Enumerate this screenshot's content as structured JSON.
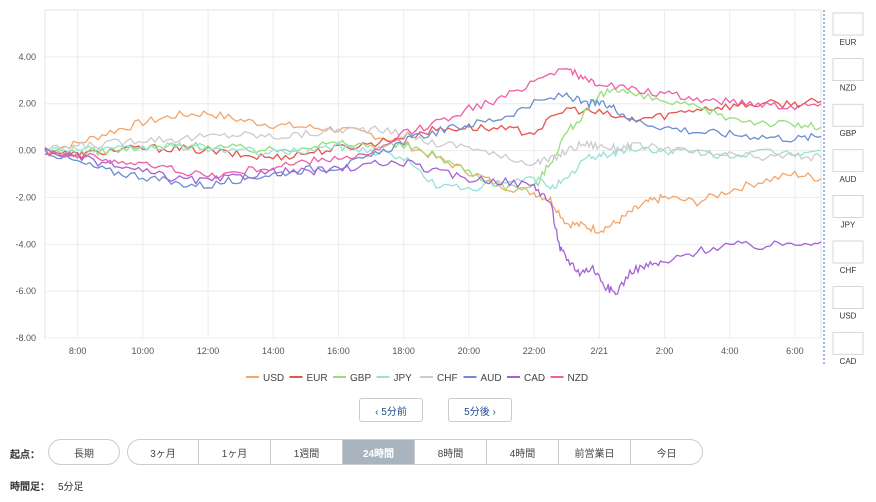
{
  "chart_data": {
    "type": "line",
    "y_ticks": [
      "4.00",
      "2.00",
      "0.00",
      "-2.00",
      "-4.00",
      "-6.00",
      "-8.00"
    ],
    "ylim": [
      -8,
      6
    ],
    "x_ticks": [
      "8:00",
      "10:00",
      "12:00",
      "14:00",
      "16:00",
      "18:00",
      "20:00",
      "22:00",
      "2/21",
      "2:00",
      "4:00",
      "6:00"
    ],
    "x_tick_hours": [
      1,
      3,
      5,
      7,
      9,
      11,
      13,
      15,
      17,
      19,
      21,
      23
    ],
    "xlim": [
      0,
      23.8
    ],
    "series": [
      {
        "name": "USD",
        "color": "#f4a56b",
        "points": [
          [
            0,
            0
          ],
          [
            1,
            0.3
          ],
          [
            2,
            0.8
          ],
          [
            3,
            1.2
          ],
          [
            4,
            1.5
          ],
          [
            5,
            1.6
          ],
          [
            6,
            1.3
          ],
          [
            7,
            1.1
          ],
          [
            8,
            1.0
          ],
          [
            9,
            0.9
          ],
          [
            10,
            0.7
          ],
          [
            11,
            0.3
          ],
          [
            12,
            -0.3
          ],
          [
            13,
            -0.9
          ],
          [
            14,
            -1.5
          ],
          [
            15,
            -1.8
          ],
          [
            15.5,
            -2.1
          ],
          [
            16,
            -3.1
          ],
          [
            16.5,
            -3.2
          ],
          [
            17,
            -3.4
          ],
          [
            17.5,
            -3.1
          ],
          [
            18,
            -2.6
          ],
          [
            18.5,
            -2.2
          ],
          [
            19,
            -2.0
          ],
          [
            20,
            -2.2
          ],
          [
            21,
            -1.7
          ],
          [
            22,
            -1.3
          ],
          [
            23,
            -1.0
          ],
          [
            23.8,
            -1.2
          ]
        ]
      },
      {
        "name": "EUR",
        "color": "#e8534d",
        "points": [
          [
            0,
            0
          ],
          [
            1,
            -0.2
          ],
          [
            2,
            0
          ],
          [
            3,
            0.1
          ],
          [
            4,
            0.1
          ],
          [
            5,
            0
          ],
          [
            6,
            -0.2
          ],
          [
            7,
            -0.3
          ],
          [
            8,
            -0.1
          ],
          [
            9,
            0.1
          ],
          [
            10,
            0.3
          ],
          [
            11,
            0.6
          ],
          [
            12,
            0.9
          ],
          [
            13,
            1.0
          ],
          [
            14,
            0.9
          ],
          [
            15,
            0.8
          ],
          [
            16,
            1.8
          ],
          [
            17,
            1.6
          ],
          [
            18,
            1.3
          ],
          [
            19,
            1.5
          ],
          [
            20,
            1.8
          ],
          [
            21,
            1.9
          ],
          [
            22,
            2.0
          ],
          [
            23,
            2.0
          ],
          [
            23.8,
            2.1
          ]
        ]
      },
      {
        "name": "GBP",
        "color": "#93e07b",
        "points": [
          [
            0,
            0
          ],
          [
            1,
            -0.1
          ],
          [
            2,
            0
          ],
          [
            3,
            0.1
          ],
          [
            4,
            0.2
          ],
          [
            5,
            0.2
          ],
          [
            6,
            0.1
          ],
          [
            7,
            0
          ],
          [
            8,
            0.2
          ],
          [
            9,
            0.3
          ],
          [
            10,
            0.2
          ],
          [
            11,
            0.2
          ],
          [
            12,
            -0.2
          ],
          [
            13,
            -0.9
          ],
          [
            14,
            -1.5
          ],
          [
            15,
            -1.6
          ],
          [
            15.5,
            -0.5
          ],
          [
            16,
            0.8
          ],
          [
            16.5,
            1.5
          ],
          [
            17,
            2.3
          ],
          [
            17.5,
            2.7
          ],
          [
            18,
            2.4
          ],
          [
            19,
            2.1
          ],
          [
            20,
            1.8
          ],
          [
            21,
            1.4
          ],
          [
            22,
            1.2
          ],
          [
            23,
            1.1
          ],
          [
            23.8,
            1.0
          ]
        ]
      },
      {
        "name": "JPY",
        "color": "#95e2d8",
        "points": [
          [
            0,
            0
          ],
          [
            1,
            0.1
          ],
          [
            2,
            0
          ],
          [
            3,
            0.1
          ],
          [
            4,
            0.2
          ],
          [
            5,
            0.1
          ],
          [
            6,
            0
          ],
          [
            7,
            -0.1
          ],
          [
            8,
            0
          ],
          [
            9,
            0.2
          ],
          [
            10,
            0
          ],
          [
            11,
            -0.3
          ],
          [
            12,
            -1.5
          ],
          [
            13,
            -1.6
          ],
          [
            14,
            -1.4
          ],
          [
            15,
            -1.2
          ],
          [
            15.5,
            -1.5
          ],
          [
            16,
            -1.3
          ],
          [
            16.5,
            -0.4
          ],
          [
            17,
            -0.2
          ],
          [
            17.5,
            -0.1
          ],
          [
            18,
            0.1
          ],
          [
            19,
            0.0
          ],
          [
            20,
            -0.1
          ],
          [
            21,
            -0.2
          ],
          [
            22,
            -0.1
          ],
          [
            23,
            -0.1
          ],
          [
            23.8,
            0.0
          ]
        ]
      },
      {
        "name": "CHF",
        "color": "#cccccc",
        "points": [
          [
            0,
            0
          ],
          [
            1,
            0.2
          ],
          [
            2,
            0.3
          ],
          [
            3,
            0.5
          ],
          [
            4,
            0.5
          ],
          [
            5,
            0.6
          ],
          [
            6,
            0.7
          ],
          [
            7,
            0.6
          ],
          [
            8,
            0.7
          ],
          [
            9,
            0.9
          ],
          [
            10,
            0.9
          ],
          [
            11,
            0.7
          ],
          [
            12,
            0.3
          ],
          [
            13,
            0.2
          ],
          [
            14,
            -0.3
          ],
          [
            15,
            -0.5
          ],
          [
            15.5,
            -0.4
          ],
          [
            16,
            0
          ],
          [
            16.5,
            0.3
          ],
          [
            17,
            0.2
          ],
          [
            17.5,
            0.1
          ],
          [
            18,
            0.2
          ],
          [
            19,
            0.1
          ],
          [
            20,
            -0.1
          ],
          [
            21,
            -0.2
          ],
          [
            22,
            -0.3
          ],
          [
            23,
            -0.2
          ],
          [
            23.8,
            -0.3
          ]
        ]
      },
      {
        "name": "AUD",
        "color": "#6c8fd0",
        "points": [
          [
            0,
            0
          ],
          [
            1,
            -0.5
          ],
          [
            2,
            -0.9
          ],
          [
            3,
            -1.1
          ],
          [
            4,
            -1.4
          ],
          [
            5,
            -1.5
          ],
          [
            6,
            -1.2
          ],
          [
            7,
            -1.0
          ],
          [
            8,
            -0.8
          ],
          [
            9,
            -0.7
          ],
          [
            10,
            -0.3
          ],
          [
            11,
            0.4
          ],
          [
            12,
            0.8
          ],
          [
            13,
            1.1
          ],
          [
            14,
            1.4
          ],
          [
            15,
            2.0
          ],
          [
            16,
            2.4
          ],
          [
            16.5,
            2.0
          ],
          [
            17,
            2.0
          ],
          [
            17.5,
            1.8
          ],
          [
            18,
            1.3
          ],
          [
            19,
            1.0
          ],
          [
            20,
            0.8
          ],
          [
            21,
            0.7
          ],
          [
            22,
            0.6
          ],
          [
            23,
            0.5
          ],
          [
            23.8,
            0.6
          ]
        ]
      },
      {
        "name": "CAD",
        "color": "#a462d6",
        "points": [
          [
            0,
            0
          ],
          [
            1,
            -0.3
          ],
          [
            2,
            -0.6
          ],
          [
            3,
            -0.9
          ],
          [
            4,
            -1.2
          ],
          [
            5,
            -1.3
          ],
          [
            6,
            -1.1
          ],
          [
            7,
            -0.9
          ],
          [
            8,
            -0.9
          ],
          [
            9,
            -0.8
          ],
          [
            10,
            -0.6
          ],
          [
            11,
            -0.5
          ],
          [
            12,
            -0.9
          ],
          [
            13,
            -1.2
          ],
          [
            14,
            -1.3
          ],
          [
            15,
            -1.5
          ],
          [
            15.5,
            -2.2
          ],
          [
            15.8,
            -4.2
          ],
          [
            16,
            -4.6
          ],
          [
            16.4,
            -5.2
          ],
          [
            16.8,
            -5.0
          ],
          [
            17.2,
            -5.8
          ],
          [
            17.5,
            -6.1
          ],
          [
            18,
            -5.1
          ],
          [
            18.5,
            -4.9
          ],
          [
            19,
            -4.8
          ],
          [
            20,
            -4.3
          ],
          [
            21,
            -4.0
          ],
          [
            22,
            -4.1
          ],
          [
            23,
            -3.9
          ],
          [
            23.8,
            -3.9
          ]
        ]
      },
      {
        "name": "NZD",
        "color": "#ef5fa6",
        "points": [
          [
            0,
            0
          ],
          [
            1,
            -0.2
          ],
          [
            2,
            -0.4
          ],
          [
            3,
            -0.6
          ],
          [
            4,
            -0.8
          ],
          [
            5,
            -1.1
          ],
          [
            6,
            -0.9
          ],
          [
            7,
            -0.7
          ],
          [
            8,
            -0.5
          ],
          [
            9,
            -0.3
          ],
          [
            10,
            -0.2
          ],
          [
            11,
            0.7
          ],
          [
            12,
            1.2
          ],
          [
            13,
            1.8
          ],
          [
            14,
            2.2
          ],
          [
            15,
            3.0
          ],
          [
            16,
            3.6
          ],
          [
            16.5,
            3.0
          ],
          [
            17,
            2.9
          ],
          [
            18,
            2.6
          ],
          [
            19,
            2.4
          ],
          [
            20,
            2.2
          ],
          [
            21,
            2.1
          ],
          [
            22,
            2.0
          ],
          [
            23,
            1.9
          ],
          [
            23.8,
            2.0
          ]
        ]
      }
    ],
    "grid": true,
    "legend": "bottom"
  },
  "flags": [
    {
      "code": "EUR",
      "icon": "eu-flag-icon"
    },
    {
      "code": "NZD",
      "icon": "nz-flag-icon"
    },
    {
      "code": "GBP",
      "icon": "uk-flag-icon"
    },
    {
      "code": "AUD",
      "icon": "au-flag-icon"
    },
    {
      "code": "JPY",
      "icon": "jp-flag-icon"
    },
    {
      "code": "CHF",
      "icon": "ch-flag-icon"
    },
    {
      "code": "USD",
      "icon": "us-flag-icon"
    },
    {
      "code": "CAD",
      "icon": "ca-flag-icon"
    }
  ],
  "nav": {
    "prev_label": "‹ 5分前",
    "next_label": "5分後 ›"
  },
  "start_label": "起点：",
  "range_options": [
    "長期",
    "3ヶ月",
    "1ヶ月",
    "1週間",
    "24時間",
    "8時間",
    "4時間",
    "前営業日",
    "今日"
  ],
  "active_range": "24時間",
  "interval_label": "時間足：",
  "interval_value": "5分足"
}
